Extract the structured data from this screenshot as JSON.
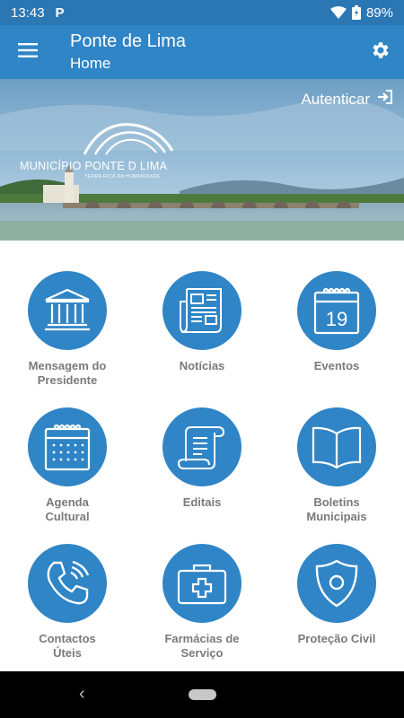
{
  "status_bar": {
    "time": "13:43",
    "notification_icon": "P",
    "battery": "89%"
  },
  "app_bar": {
    "title": "Ponte de Lima",
    "subtitle": "Home"
  },
  "hero": {
    "login_label": "Autenticar",
    "brand_name": "MUNICÍPIO PONTE D LIMA",
    "brand_tagline": "TERRA RICA DA HUMANIDADE"
  },
  "tiles": [
    {
      "label": "Mensagem do Presidente",
      "icon": "building-columns-icon"
    },
    {
      "label": "Notícias",
      "icon": "newspaper-icon"
    },
    {
      "label": "Eventos",
      "icon": "calendar-19-icon"
    },
    {
      "label": "Agenda Cultural",
      "icon": "calendar-grid-icon"
    },
    {
      "label": "Editais",
      "icon": "scroll-icon"
    },
    {
      "label": "Boletins Municipais",
      "icon": "open-book-icon"
    },
    {
      "label": "Contactos Úteis",
      "icon": "phone-icon"
    },
    {
      "label": "Farmácias de Serviço",
      "icon": "first-aid-kit-icon"
    },
    {
      "label": "Proteção Civil",
      "icon": "shield-icon"
    }
  ],
  "calendar_day": "19",
  "colors": {
    "primary": "#2f85c6",
    "status": "#2a77b3",
    "label": "#7a7a7a"
  }
}
